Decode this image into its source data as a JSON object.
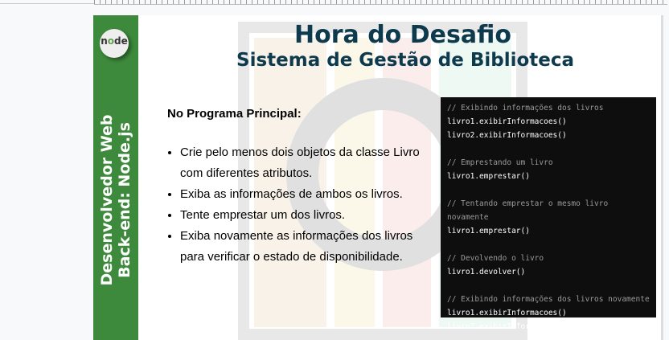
{
  "logo": {
    "text": "node"
  },
  "sidebar": {
    "line1": "Desenvolvedor Web",
    "line2": "Back-end: Node.js"
  },
  "title": "Hora do Desafio",
  "subtitle": "Sistema de Gestão de Biblioteca",
  "heading": "No Programa Principal:",
  "bullets": [
    "Crie pelo menos dois objetos da classe Livro com diferentes atributos.",
    "Exiba as informações de ambos os livros.",
    "Tente emprestar um dos livros.",
    "Exiba novamente as informações dos livros para verificar o estado de disponibilidade."
  ],
  "code": [
    "// Exibindo informações dos livros",
    "livro1.exibirInformacoes()",
    "livro2.exibirInformacoes()",
    "",
    "// Emprestando um livro",
    "livro1.emprestar()",
    "",
    "// Tentando emprestar o mesmo livro novamente",
    "livro1.emprestar()",
    "",
    "// Devolvendo o livro",
    "livro1.devolver()",
    "",
    "// Exibindo informações dos livros novamente",
    "livro1.exibirInformacoes()",
    "livro2.exibirInformacoes()"
  ]
}
